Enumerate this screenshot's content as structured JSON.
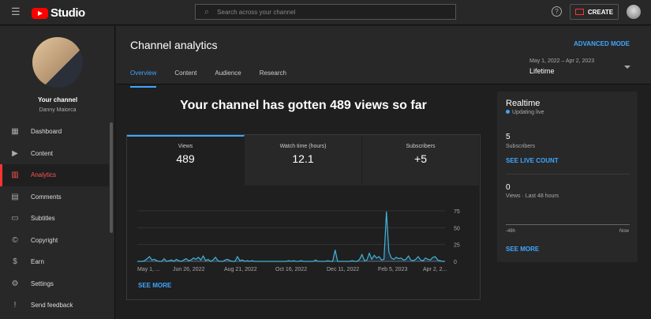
{
  "header": {
    "logo": "Studio",
    "search_placeholder": "Search across your channel",
    "create": "CREATE",
    "help": "?"
  },
  "sidebar": {
    "channel_title": "Your channel",
    "channel_name": "Danny Maiorca",
    "items": [
      {
        "label": "Dashboard",
        "icon": "▦"
      },
      {
        "label": "Content",
        "icon": "▶"
      },
      {
        "label": "Analytics",
        "icon": "▥"
      },
      {
        "label": "Comments",
        "icon": "▤"
      },
      {
        "label": "Subtitles",
        "icon": "▭"
      },
      {
        "label": "Copyright",
        "icon": "©"
      },
      {
        "label": "Earn",
        "icon": "$"
      },
      {
        "label": "Settings",
        "icon": "⚙"
      },
      {
        "label": "Send feedback",
        "icon": "!"
      }
    ]
  },
  "page": {
    "title": "Channel analytics",
    "advanced": "ADVANCED MODE",
    "tabs": [
      "Overview",
      "Content",
      "Audience",
      "Research"
    ],
    "date_range": "May 1, 2022 – Apr 2, 2023",
    "period": "Lifetime"
  },
  "headline": "Your channel has gotten 489 views so far",
  "metrics": [
    {
      "label": "Views",
      "value": "489"
    },
    {
      "label": "Watch time (hours)",
      "value": "12.1"
    },
    {
      "label": "Subscribers",
      "value": "+5"
    }
  ],
  "see_more": "SEE MORE",
  "chart_data": {
    "type": "line",
    "title": "Views",
    "ylim": [
      0,
      75
    ],
    "yticks": [
      "75",
      "50",
      "25",
      "0"
    ],
    "xticks": [
      "May 1, ...",
      "Jun 26, 2022",
      "Aug 21, 2022",
      "Oct 16, 2022",
      "Dec 11, 2022",
      "Feb 5, 2023",
      "Apr 2, 2..."
    ],
    "values": [
      0,
      0,
      0,
      1,
      4,
      7,
      2,
      3,
      1,
      0,
      0,
      4,
      0,
      1,
      2,
      0,
      3,
      1,
      0,
      2,
      4,
      1,
      2,
      5,
      3,
      6,
      2,
      8,
      1,
      3,
      0,
      2,
      6,
      1,
      0,
      0,
      2,
      3,
      1,
      0,
      0,
      7,
      1,
      2,
      0,
      1,
      0,
      1,
      0,
      0,
      0,
      0,
      0,
      0,
      0,
      0,
      0,
      0,
      0,
      0,
      0,
      0,
      1,
      0,
      1,
      0,
      0,
      1,
      0,
      0,
      0,
      0,
      0,
      2,
      0,
      0,
      0,
      0,
      1,
      0,
      0,
      17,
      0,
      0,
      0,
      0,
      0,
      0,
      1,
      0,
      0,
      3,
      10,
      1,
      2,
      12,
      3,
      9,
      5,
      7,
      2,
      3,
      74,
      14,
      5,
      3,
      6,
      4,
      5,
      2,
      3,
      8,
      2,
      1,
      3,
      7,
      2,
      1,
      5,
      3,
      2,
      6,
      7,
      2,
      1,
      0,
      0
    ]
  },
  "realtime": {
    "title": "Realtime",
    "status": "Updating live",
    "subs_value": "5",
    "subs_label": "Subscribers",
    "live_count": "SEE LIVE COUNT",
    "views_value": "0",
    "views_label": "Views · Last 48 hours",
    "axis_start": "-48h",
    "axis_end": "Now",
    "see_more": "SEE MORE"
  }
}
